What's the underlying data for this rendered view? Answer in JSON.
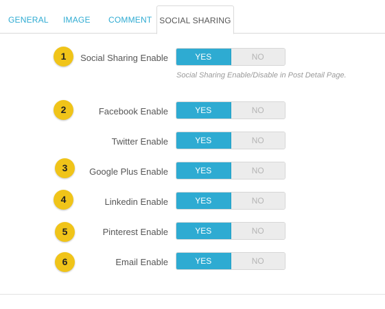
{
  "tabs": [
    {
      "label": "GENERAL"
    },
    {
      "label": "IMAGE"
    },
    {
      "label": "COMMENT"
    },
    {
      "label": "SOCIAL SHARING",
      "active": true
    }
  ],
  "settings": [
    {
      "badge": "1",
      "label": "Social Sharing Enable",
      "yes": "YES",
      "no": "NO",
      "selected": "YES",
      "help": "Social Sharing Enable/Disable in Post Detail Page."
    },
    {
      "badge": "2",
      "label": "Facebook Enable",
      "yes": "YES",
      "no": "NO",
      "selected": "YES"
    },
    {
      "badge": "",
      "label": "Twitter Enable",
      "yes": "YES",
      "no": "NO",
      "selected": "YES"
    },
    {
      "badge": "3",
      "label": "Google Plus Enable",
      "yes": "YES",
      "no": "NO",
      "selected": "YES"
    },
    {
      "badge": "4",
      "label": "Linkedin Enable",
      "yes": "YES",
      "no": "NO",
      "selected": "YES"
    },
    {
      "badge": "5",
      "label": "Pinterest Enable",
      "yes": "YES",
      "no": "NO",
      "selected": "YES"
    },
    {
      "badge": "6",
      "label": "Email Enable",
      "yes": "YES",
      "no": "NO",
      "selected": "YES"
    }
  ],
  "colors": {
    "accent": "#2eabd2",
    "badge": "#f0c419",
    "toggle_off": "#ececec"
  }
}
